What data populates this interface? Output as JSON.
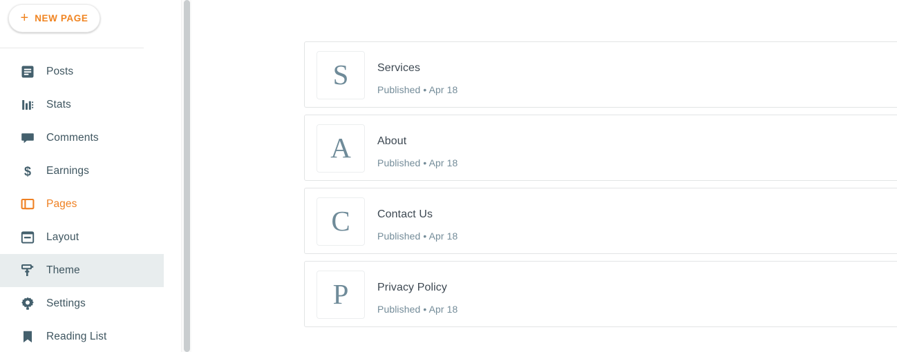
{
  "sidebar": {
    "new_page_button": {
      "label": "NEW PAGE",
      "icon": "plus-icon",
      "color": "#f08421"
    },
    "items": [
      {
        "label": "Posts",
        "icon": "posts-icon",
        "state": "default"
      },
      {
        "label": "Stats",
        "icon": "stats-icon",
        "state": "default"
      },
      {
        "label": "Comments",
        "icon": "comments-icon",
        "state": "default"
      },
      {
        "label": "Earnings",
        "icon": "dollar-icon",
        "state": "default"
      },
      {
        "label": "Pages",
        "icon": "pages-icon",
        "state": "accent"
      },
      {
        "label": "Layout",
        "icon": "layout-icon",
        "state": "default"
      },
      {
        "label": "Theme",
        "icon": "paint-roller-icon",
        "state": "selected"
      },
      {
        "label": "Settings",
        "icon": "gear-icon",
        "state": "default"
      },
      {
        "label": "Reading List",
        "icon": "bookmark-icon",
        "state": "default"
      }
    ],
    "scrollbar": {
      "name": "sidebar-scrollbar"
    }
  },
  "main": {
    "pages": [
      {
        "avatar_letter": "S",
        "title": "Services",
        "status": "Published",
        "separator": "•",
        "date": "Apr 18",
        "meta": "Published • Apr 18",
        "action_icon": "more-options-icon"
      },
      {
        "avatar_letter": "A",
        "title": "About",
        "status": "Published",
        "separator": "•",
        "date": "Apr 18",
        "meta": "Published • Apr 18",
        "action_icon": "more-options-icon"
      },
      {
        "avatar_letter": "C",
        "title": "Contact Us",
        "status": "Published",
        "separator": "•",
        "date": "Apr 18",
        "meta": "Published • Apr 18",
        "action_icon": "more-options-icon"
      },
      {
        "avatar_letter": "P",
        "title": "Privacy Policy",
        "status": "Published",
        "separator": "•",
        "date": "Apr 18",
        "meta": "Published • Apr 18",
        "action_icon": "more-options-icon"
      }
    ]
  },
  "colors": {
    "accent_orange": "#ef8022",
    "icon_slate": "#44606d",
    "text_primary": "#3d4852",
    "text_muted": "#748c99",
    "selected_row_bg": "#e8edee",
    "card_border": "#e2e4e5"
  }
}
